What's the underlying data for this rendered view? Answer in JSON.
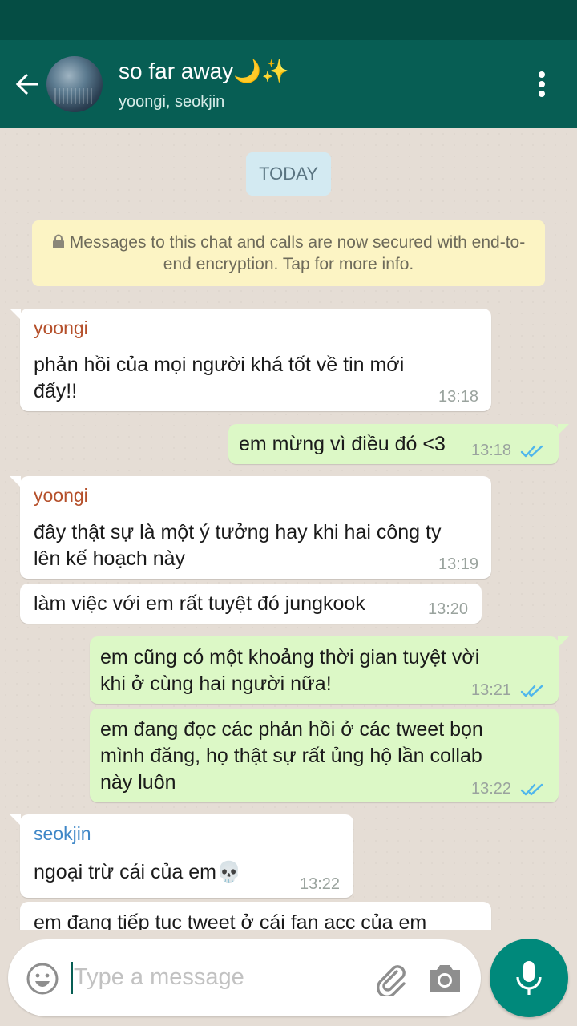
{
  "header": {
    "title": "so far away🌙✨",
    "subtitle": "yoongi, seokjin"
  },
  "chat": {
    "date_label": "TODAY",
    "security_notice": "Messages to this chat and calls are now secured with end-to-end encryption. Tap for more info.",
    "messages": [
      {
        "sender": "yoongi",
        "line1": "phản hồi của mọi người khá tốt về tin mới",
        "line2": "đấy!!",
        "time": "13:18"
      },
      {
        "text": "em mừng vì điều đó <3",
        "time": "13:18"
      },
      {
        "sender": "yoongi",
        "line1": "đây thật sự là một ý tưởng hay khi hai công ty",
        "line2": "lên kế hoạch này",
        "time": "13:19"
      },
      {
        "text": "làm việc với em rất tuyệt đó jungkook",
        "time": "13:20"
      },
      {
        "line1": "em cũng có một khoảng thời gian tuyệt vời",
        "line2": "khi ở cùng hai người nữa!",
        "time": "13:21"
      },
      {
        "line1": "em đang đọc các phản hồi ở các tweet bọn",
        "line2": "mình đăng, họ thật sự rất ủng hộ lần collab",
        "line3": "này luôn",
        "time": "13:22"
      },
      {
        "sender": "seokjin",
        "text": "ngoại trừ cái của em💀",
        "time": "13:22"
      },
      {
        "text": "em đang tiếp tục tweet ở cái fan acc của em"
      }
    ]
  },
  "input": {
    "placeholder": "Type a message"
  },
  "colors": {
    "header": "#075e54",
    "status_bar": "#054d44",
    "outgoing_bubble": "#dcf8c6",
    "incoming_bubble": "#ffffff",
    "sender_yoongi": "#b5502b",
    "sender_seokjin": "#3f87c7",
    "read_ticks": "#4fb6ec",
    "fab": "#00897b"
  },
  "icons": [
    "back-arrow-icon",
    "more-vert-icon",
    "lock-icon",
    "double-check-icon",
    "emoji-icon",
    "attachment-icon",
    "camera-icon",
    "mic-icon"
  ]
}
